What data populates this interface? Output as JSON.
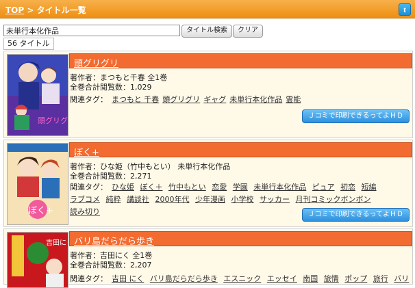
{
  "header": {
    "top_link": "TOP",
    "separator": " > ",
    "page_title": "タイトル一覧",
    "twitter_glyph": "t"
  },
  "search": {
    "value": "未単行本化作品",
    "search_button": "タイトル検索",
    "clear_button": "クリア"
  },
  "count_label": "56 タイトル",
  "colors": {
    "header": "#ee8f12",
    "title_bar": "#f26b30",
    "card_bg": "#fff9e8",
    "jcomi_button": "#2e90dd"
  },
  "titles": [
    {
      "name": "頭グリグリ",
      "author": "著作者：まつもと千春 全1巻",
      "views": "全巻合計閲覧数：1,029",
      "tags_label": "関連タグ：",
      "tags": [
        "まつもと 千春",
        "頭グリグリ",
        "ギャグ",
        "未単行本化作品",
        "霊能"
      ],
      "button": "Ｊコミで印刷できるってよＨＤ",
      "cover_text": "頭グリグリ"
    },
    {
      "name": "ぼく+",
      "author": "著作者：ひな姫（竹中もとい） 未単行本化作品",
      "views": "全巻合計閲覧数：2,271",
      "tags_label": "関連タグ：",
      "tags": [
        "ひな姫",
        "ぼく＋",
        "竹中もとい",
        "恋愛",
        "学園",
        "未単行本化作品",
        "ピュア",
        "初恋",
        "短編",
        "ラブコメ",
        "純粋",
        "講談社",
        "2000年代",
        "少年漫画",
        "小学校",
        "サッカー",
        "月刊コミックボンボン",
        "読み切り"
      ],
      "button": "Ｊコミで印刷できるってよＨＤ",
      "cover_text": "ぼく+"
    },
    {
      "name": "バリ島だらだら歩き",
      "author": "著作者：吉田にく 全1巻",
      "views": "全巻合計閲覧数：2,207",
      "tags_label": "関連タグ：",
      "tags": [
        "吉田 にく",
        "バリ島だらだら歩き",
        "エスニック",
        "エッセイ",
        "南国",
        "旅情",
        "ポップ",
        "旅行",
        "バリ"
      ],
      "cover_text": "吉田にく"
    }
  ]
}
